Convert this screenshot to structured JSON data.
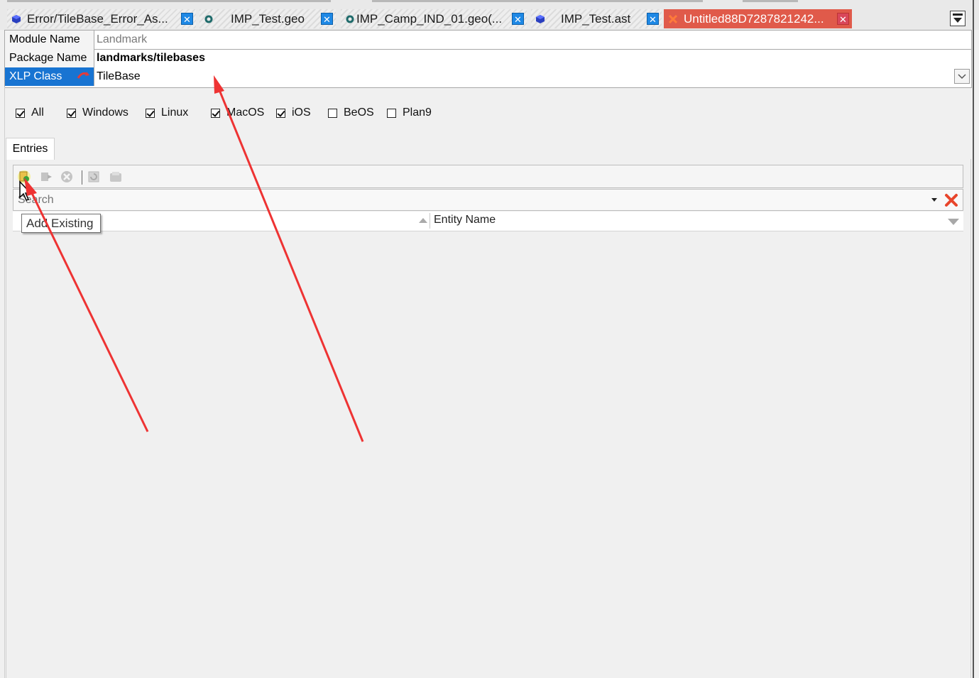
{
  "tabs": [
    {
      "label": "Error/TileBase_Error_As...",
      "icon": "blue-cube-icon",
      "active": false
    },
    {
      "label": "IMP_Test.geo",
      "icon": "gear-icon",
      "active": false
    },
    {
      "label": "IMP_Camp_IND_01.geo(...",
      "icon": "gear-icon",
      "active": false
    },
    {
      "label": "IMP_Test.ast",
      "icon": "blue-cube-icon",
      "active": false
    },
    {
      "label": "Untitled88D7287821242...",
      "icon": "red-x-icon",
      "active": true
    }
  ],
  "tab_close_glyph": "✕",
  "properties": {
    "module_name": {
      "label": "Module Name",
      "value": "Landmark"
    },
    "package_name": {
      "label": "Package Name",
      "value": "landmarks/tilebases"
    },
    "xlp_class": {
      "label": "XLP Class",
      "value": "TileBase"
    }
  },
  "platforms": [
    {
      "label": "All",
      "checked": true
    },
    {
      "label": "Windows",
      "checked": true
    },
    {
      "label": "Linux",
      "checked": true
    },
    {
      "label": "MacOS",
      "checked": true
    },
    {
      "label": "iOS",
      "checked": true
    },
    {
      "label": "BeOS",
      "checked": false
    },
    {
      "label": "Plan9",
      "checked": false
    }
  ],
  "entries_tab_label": "Entries",
  "toolbar": {
    "buttons": [
      "add-existing-icon",
      "add-new-icon",
      "remove-icon",
      "refresh-icon",
      "save-icon"
    ]
  },
  "search": {
    "placeholder": "Search",
    "value": ""
  },
  "columns": {
    "entity_name": "Entity Name"
  },
  "tooltip": "Add Existing",
  "colors": {
    "selected_row": "#1874d2",
    "active_tab": "#e05a4a",
    "close_button": "#1e88e5",
    "annotation_arrow": "#ee3333"
  }
}
